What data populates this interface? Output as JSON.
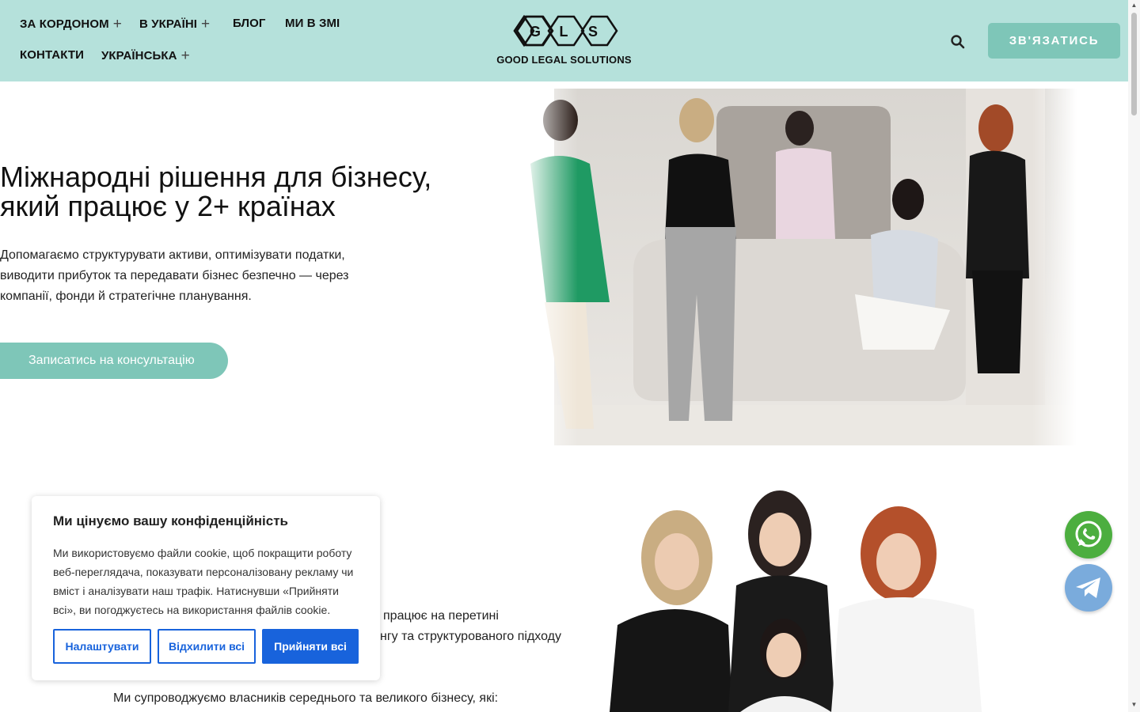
{
  "header": {
    "nav": [
      {
        "label": "ЗА КОРДОНОМ",
        "has_submenu": true
      },
      {
        "label": "В УКРАЇНІ",
        "has_submenu": true
      },
      {
        "label": "БЛОГ",
        "has_submenu": false
      },
      {
        "label": "МИ В ЗМІ",
        "has_submenu": false
      },
      {
        "label": "КОНТАКТИ",
        "has_submenu": false
      },
      {
        "label": "УКРАЇНСЬКА",
        "has_submenu": true
      }
    ],
    "plus_symbol": "+",
    "logo_letters": [
      "G",
      "L",
      "S"
    ],
    "logo_text": "GOOD LEGAL SOLUTIONS",
    "contact_button": "ЗВ'ЯЗАТИСЬ"
  },
  "hero": {
    "title_line1": "Міжнародні рішення для бізнесу,",
    "title_line2": "який працює у 2+ країнах",
    "desc_line1": "Допомагаємо структурувати активи, оптимізувати податки,",
    "desc_line2": "виводити прибуток та передавати бізнес безпечно — через",
    "desc_line3": "компанії, фонди й стратегічне планування.",
    "cta_button": "Записатись на консультацію"
  },
  "about": {
    "line1_fragment": "працює на перетині",
    "line2_fragment": "нгу та структурованого підходу",
    "line3": "Ми супроводжуємо власників середнього та великого бізнесу, які:"
  },
  "cookie": {
    "title": "Ми цінуємо вашу конфіденційність",
    "text": "Ми використовуємо файли cookie, щоб покращити роботу веб-переглядача, показувати персоналізовану рекламу чи вміст і аналізувати наш трафік. Натиснувши «Прийняти всі», ви погоджуєтесь на використання файлів cookie.",
    "btn_settings": "Налаштувати",
    "btn_reject": "Відхилити всі",
    "btn_accept": "Прийняти всі"
  },
  "colors": {
    "header_bg": "#b5e1db",
    "accent": "#7ec6b8",
    "cookie_blue": "#1863dc",
    "whatsapp": "#4cae3f",
    "telegram": "#7aabdc"
  },
  "icons": {
    "search": "search-icon",
    "whatsapp": "whatsapp-icon",
    "telegram": "telegram-icon"
  }
}
